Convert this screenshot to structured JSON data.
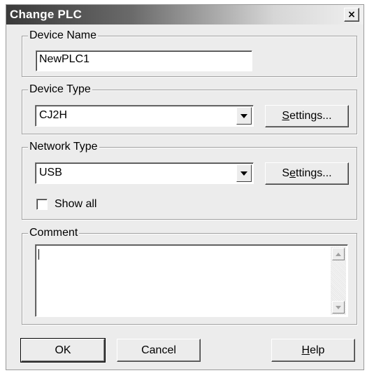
{
  "window": {
    "title": "Change PLC",
    "close_icon": "close-icon"
  },
  "device_name": {
    "group_label": "Device Name",
    "value": "NewPLC1"
  },
  "device_type": {
    "group_label": "Device Type",
    "selected": "CJ2H",
    "settings_label_accel": "S",
    "settings_label_rest": "ettings..."
  },
  "network_type": {
    "group_label": "Network Type",
    "selected": "USB",
    "settings_label_pre": "S",
    "settings_label_accel": "e",
    "settings_label_rest": "ttings...",
    "show_all_label": "Show all",
    "show_all_checked": false
  },
  "comment": {
    "group_label": "Comment",
    "value": ""
  },
  "buttons": {
    "ok": "OK",
    "cancel": "Cancel",
    "help_accel": "H",
    "help_rest": "elp"
  },
  "colors": {
    "dialog_bg": "#ececec",
    "title_start": "#3a3a3a",
    "title_end": "#f0f0f0"
  }
}
